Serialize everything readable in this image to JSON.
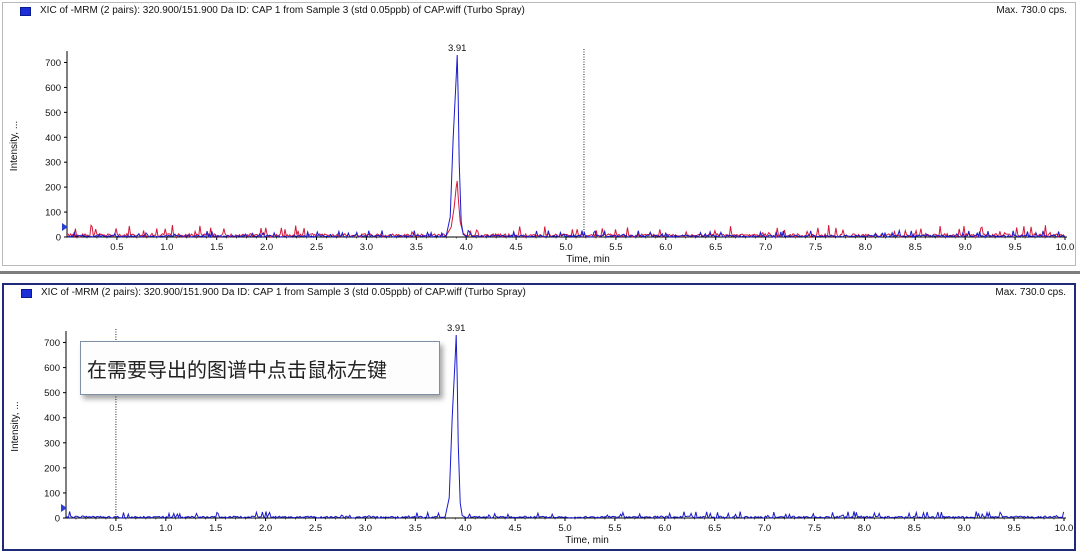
{
  "panels": [
    {
      "title": "XIC of -MRM (2 pairs): 320.900/151.900 Da ID: CAP 1 from Sample 3 (std 0.05ppb) of CAP.wiff (Turbo Spray)",
      "max_label": "Max. 730.0 cps.",
      "peak_label": "3.91",
      "marker_time": 5.18
    },
    {
      "title": "XIC of -MRM (2 pairs): 320.900/151.900 Da ID: CAP 1 from Sample 3 (std 0.05ppb) of CAP.wiff (Turbo Spray)",
      "max_label": "Max. 730.0 cps.",
      "peak_label": "3.91",
      "marker_time": 0.5,
      "callout_text": "在需要导出的图谱中点击鼠标左键"
    }
  ],
  "chart_data": [
    {
      "type": "line",
      "title": "XIC of -MRM (2 pairs): 320.900/151.900 Da ID: CAP 1 from Sample 3 (std 0.05ppb) of CAP.wiff (Turbo Spray)",
      "xlabel": "Time, min",
      "ylabel": "Intensity, ...",
      "xlim": [
        0,
        10.0
      ],
      "ylim": [
        0,
        730
      ],
      "x_ticks": [
        "0.5",
        "1.0",
        "1.5",
        "2.0",
        "2.5",
        "3.0",
        "3.5",
        "4.0",
        "4.5",
        "5.0",
        "5.5",
        "6.0",
        "6.5",
        "7.0",
        "7.5",
        "8.0",
        "8.5",
        "9.0",
        "9.5",
        "10.0"
      ],
      "y_ticks": [
        "0",
        "100",
        "200",
        "300",
        "400",
        "500",
        "600",
        "700"
      ],
      "colors": {
        "series_1": "#1a1acc",
        "series_2": "#d41a3a"
      },
      "series": [
        {
          "color": "#1a1acc",
          "x": [
            3.8,
            3.84,
            3.87,
            3.89,
            3.9,
            3.91,
            3.92,
            3.93,
            3.95,
            3.97,
            4.0
          ],
          "values": [
            5,
            80,
            400,
            560,
            640,
            730,
            560,
            300,
            60,
            10,
            3
          ]
        },
        {
          "color": "#d41a3a",
          "x": [
            3.8,
            3.85,
            3.88,
            3.9,
            3.91,
            3.92,
            3.94,
            3.97,
            4.0
          ],
          "values": [
            5,
            40,
            120,
            200,
            225,
            160,
            60,
            15,
            5
          ]
        }
      ],
      "baseline_noise": {
        "blue_max": 12,
        "red_max": 22
      }
    },
    {
      "type": "line",
      "title": "XIC of -MRM (2 pairs): 320.900/151.900 Da ID: CAP 1 from Sample 3 (std 0.05ppb) of CAP.wiff (Turbo Spray)",
      "xlabel": "Time, min",
      "ylabel": "Intensity, ...",
      "xlim": [
        0,
        10.0
      ],
      "ylim": [
        0,
        730
      ],
      "x_ticks": [
        "0.5",
        "1.0",
        "1.5",
        "2.0",
        "2.5",
        "3.0",
        "3.5",
        "4.0",
        "4.5",
        "5.0",
        "5.5",
        "6.0",
        "6.5",
        "7.0",
        "7.5",
        "8.0",
        "8.5",
        "9.0",
        "9.5",
        "10.0"
      ],
      "y_ticks": [
        "0",
        "100",
        "200",
        "300",
        "400",
        "500",
        "600",
        "700"
      ],
      "colors": {
        "series_1": "#1a1acc"
      },
      "series": [
        {
          "color": "#1a1acc",
          "x": [
            3.8,
            3.84,
            3.87,
            3.89,
            3.9,
            3.91,
            3.92,
            3.93,
            3.95,
            3.97,
            4.0
          ],
          "values": [
            5,
            80,
            400,
            560,
            640,
            730,
            560,
            300,
            60,
            10,
            3
          ]
        }
      ],
      "baseline_noise": {
        "blue_max": 12
      }
    }
  ]
}
